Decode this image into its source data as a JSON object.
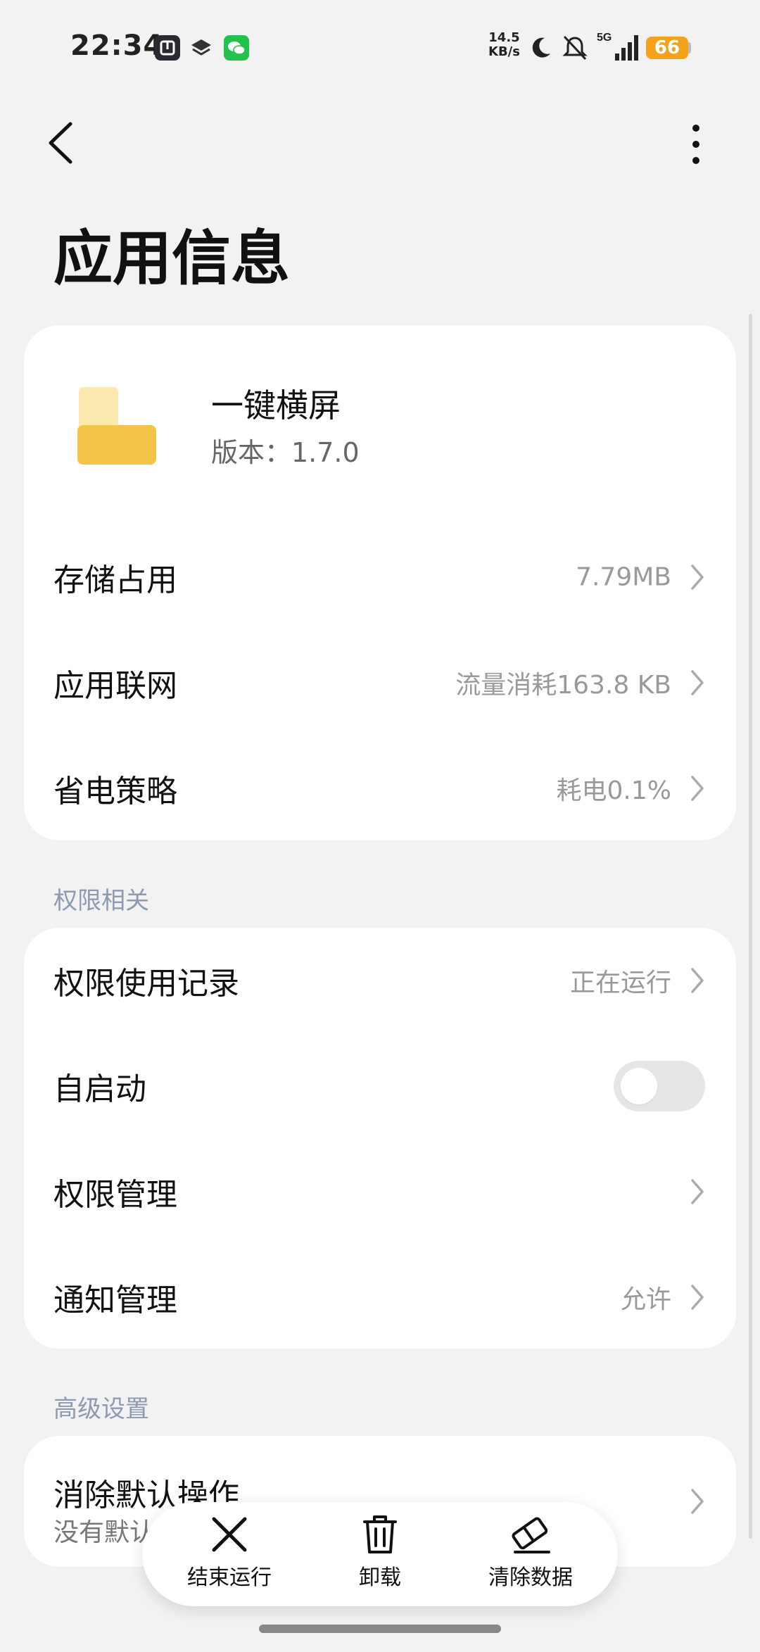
{
  "status_bar": {
    "time": "22:34",
    "net_speed_value": "14.5",
    "net_speed_unit": "KB/s",
    "network": "5G",
    "battery": "66",
    "battery_color": "#f3a21b"
  },
  "header": {
    "title": "应用信息"
  },
  "app": {
    "name": "一键横屏",
    "version": "版本：1.7.0",
    "icon_colors": [
      "#fbe9b0",
      "#f4c44a"
    ]
  },
  "info_rows": [
    {
      "label": "存储占用",
      "value": "7.79MB"
    },
    {
      "label": "应用联网",
      "value": "流量消耗163.8 KB"
    },
    {
      "label": "省电策略",
      "value": "耗电0.1%"
    }
  ],
  "permissions_section": {
    "title": "权限相关",
    "rows": [
      {
        "label": "权限使用记录",
        "value": "正在运行"
      },
      {
        "label": "自启动",
        "toggle_on": false
      },
      {
        "label": "权限管理",
        "value": ""
      },
      {
        "label": "通知管理",
        "value": "允许"
      }
    ]
  },
  "advanced_section": {
    "title": "高级设置",
    "rows": [
      {
        "label": "消除默认操作",
        "sublabel": "没有默认"
      }
    ]
  },
  "actions": [
    {
      "label": "结束运行",
      "icon": "close-icon"
    },
    {
      "label": "卸载",
      "icon": "trash-icon"
    },
    {
      "label": "清除数据",
      "icon": "eraser-icon"
    }
  ]
}
